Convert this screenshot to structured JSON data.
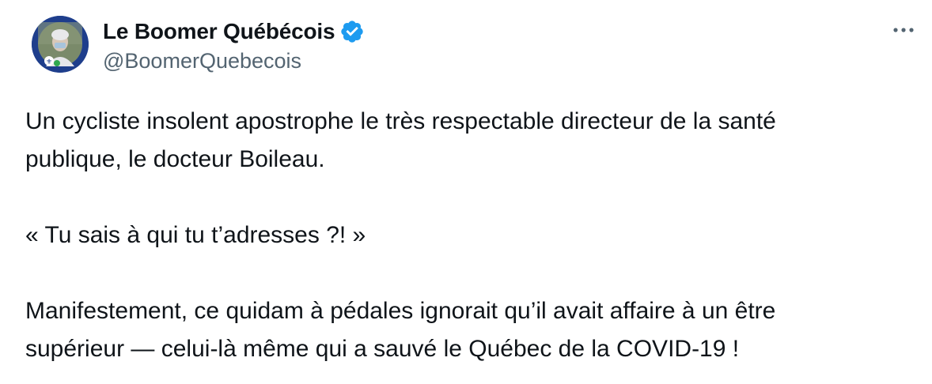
{
  "author": {
    "display_name": "Le Boomer Québécois",
    "handle": "@BoomerQuebecois",
    "verified_icon": "verified-badge-icon",
    "avatar_icon": "profile-photo"
  },
  "menu": {
    "more_icon": "more-options-icon"
  },
  "tweet": {
    "lines": [
      "Un cycliste insolent apostrophe le très respectable directeur de la santé",
      "publique, le docteur Boileau.",
      "« Tu sais à qui tu t’adresses ?! »",
      "Manifestement, ce quidam à pédales ignorait qu’il avait affaire à un être",
      "supérieur — celui-là même qui a sauvé le Québec de la COVID-19 !"
    ]
  },
  "colors": {
    "text": "#0f1419",
    "secondary": "#536471",
    "verified": "#1d9bf0"
  }
}
